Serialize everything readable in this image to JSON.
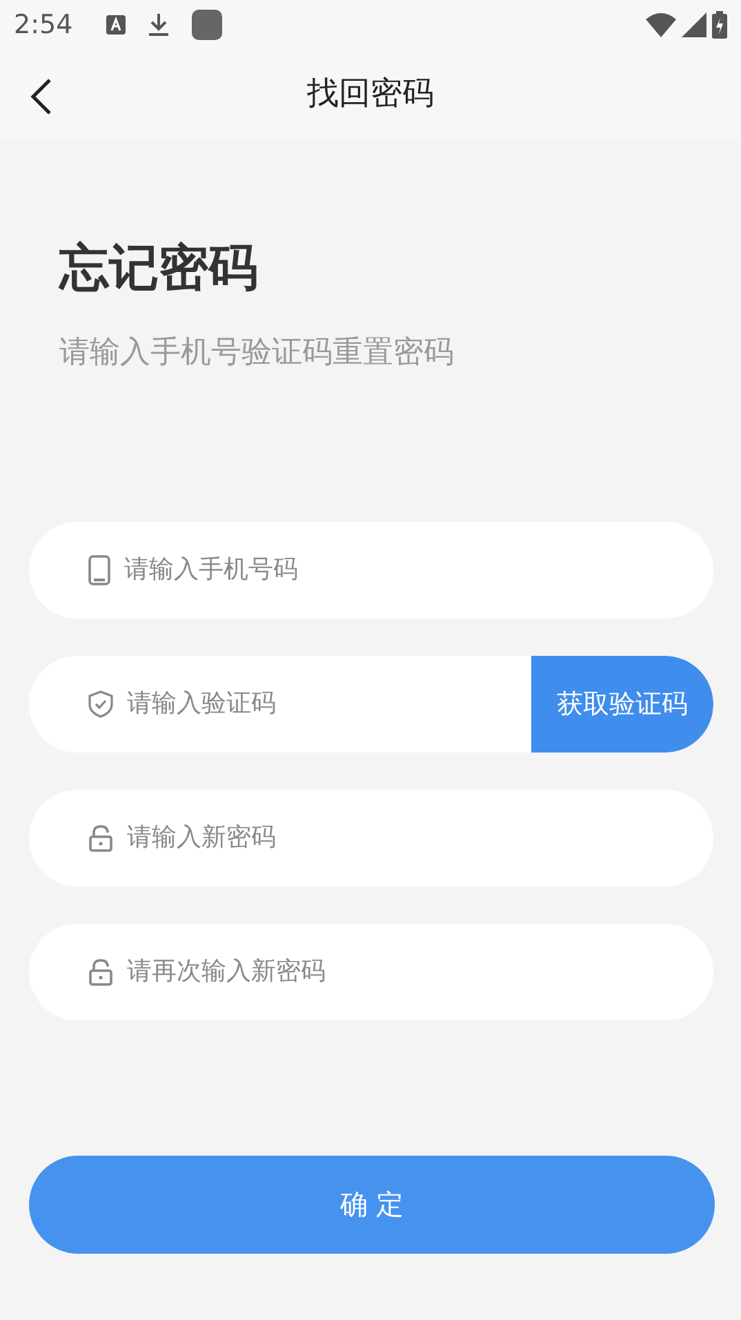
{
  "status_bar": {
    "time": "2:54"
  },
  "header": {
    "title": "找回密码"
  },
  "heading": "忘记密码",
  "subtitle": "请输入手机号验证码重置密码",
  "fields": [
    {
      "kind": "phone",
      "placeholder": "请输入手机号码"
    },
    {
      "kind": "code",
      "placeholder": "请输入验证码",
      "button": "获取验证码"
    },
    {
      "kind": "password",
      "placeholder": "请输入新密码"
    },
    {
      "kind": "password",
      "placeholder": "请再次输入新密码"
    }
  ],
  "confirm_button": "确 定"
}
